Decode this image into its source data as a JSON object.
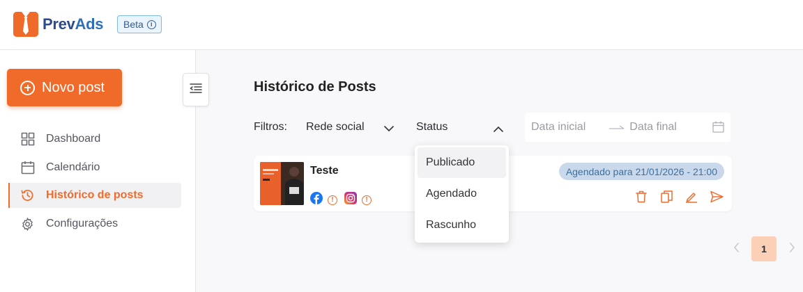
{
  "header": {
    "logo_prev": "Prev",
    "logo_ads": "Ads",
    "beta_label": "Beta",
    "beta_icon": "info-icon"
  },
  "sidebar": {
    "new_post_label": "Novo post",
    "items": [
      {
        "label": "Dashboard",
        "icon": "grid-icon",
        "active": false
      },
      {
        "label": "Calendário",
        "icon": "calendar-icon",
        "active": false
      },
      {
        "label": "Histórico de posts",
        "icon": "history-clock-icon",
        "active": true
      },
      {
        "label": "Configurações",
        "icon": "gear-icon",
        "active": false
      }
    ]
  },
  "main": {
    "title": "Histórico de Posts",
    "filters": {
      "label": "Filtros:",
      "social_network": "Rede social",
      "status": "Status",
      "date_start_placeholder": "Data inicial",
      "date_end_placeholder": "Data final"
    },
    "status_dropdown": {
      "options": [
        "Publicado",
        "Agendado",
        "Rascunho"
      ],
      "highlighted": "Publicado"
    },
    "posts": [
      {
        "title": "Teste",
        "badge": "Agendado para 21/01/2026 - 21:00",
        "networks": [
          "facebook",
          "instagram"
        ]
      }
    ],
    "pagination": {
      "current_page": "1"
    }
  },
  "colors": {
    "brand_orange": "#f06b2a",
    "logo_dark_blue": "#2e4a8c",
    "badge_blue_bg": "#c9d9eb",
    "badge_blue_text": "#3a6fa3",
    "page_active_bg": "#fbd0b7"
  }
}
